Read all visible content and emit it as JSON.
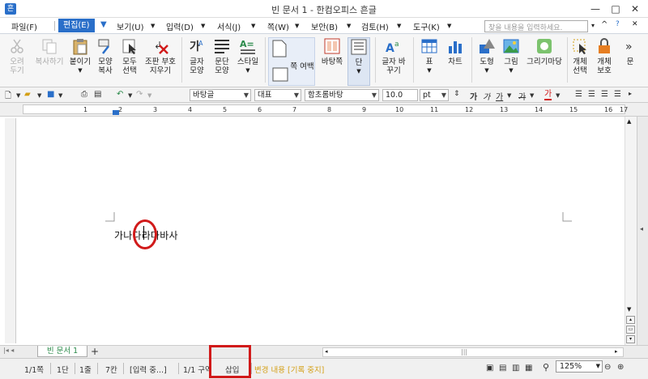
{
  "window": {
    "title": "빈 문서 1 - 한컴오피스 흔글",
    "minimize": "—",
    "maximize": "□",
    "close": "✕"
  },
  "menu": {
    "items": [
      "파일(F)",
      "편집(E)",
      "보기(U)",
      "입력(D)",
      "서식(J)",
      "쪽(W)",
      "보안(B)",
      "검토(H)",
      "도구(K)"
    ],
    "active_index": 1,
    "search_placeholder": "찾을 내용을 입력하세요."
  },
  "ribbon": {
    "cut": "오려 두기",
    "copy": "복사하기",
    "paste": "붙이기",
    "format_copy": "모양 복사",
    "select_all": "모두 선택",
    "clear_protect": "조판 부호 지우기",
    "char_shape": "글자 모양",
    "para_shape": "문단 모양",
    "style": "스타일",
    "page_margin": "쪽 여백",
    "background": "바탕쪽",
    "column": "단",
    "char_change": "글자 바꾸기",
    "table": "표",
    "chart": "차트",
    "shape": "도형",
    "picture": "그림",
    "drawing_market": "그리기마당",
    "object_select": "개체 선택",
    "object_protect": "개체 보호",
    "more": "문"
  },
  "format_bar": {
    "style": "바탕글",
    "lang": "대표",
    "font": "함초롬바탕",
    "size": "10.0",
    "unit": "pt",
    "bold": "가",
    "italic": "가",
    "underline": "가",
    "strike": "가",
    "color": "가"
  },
  "ruler": {
    "numbers": [
      "1",
      "2",
      "3",
      "4",
      "5",
      "6",
      "7",
      "8",
      "9",
      "10",
      "11",
      "12",
      "13",
      "14",
      "15",
      "16",
      "17"
    ]
  },
  "document": {
    "text": "가나다라마바사"
  },
  "tabs": {
    "doc_tab": "빈 문서 1",
    "add": "+"
  },
  "status": {
    "page": "1/1쪽",
    "column": "1단",
    "line": "1줄",
    "col": "7칸",
    "input_mode": "[입력 중...]",
    "section": "1/1 구역",
    "insert": "삽입",
    "track": "변경 내용 [기록 중지]",
    "zoom": "125%"
  },
  "colors": {
    "accent": "#2a6fc9",
    "highlight": "#d11a1a"
  }
}
